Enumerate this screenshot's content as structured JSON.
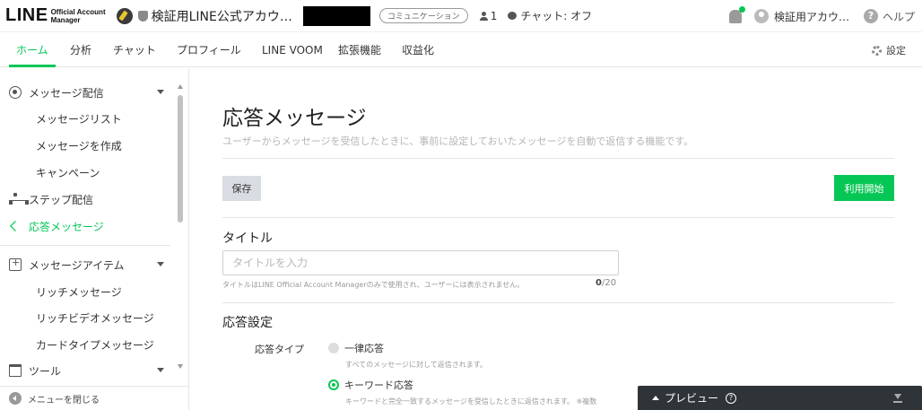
{
  "header": {
    "logo_main": "LINE",
    "logo_sub_1": "Official Account",
    "logo_sub_2": "Manager",
    "account_name": "検証用LINE公式アカウ…",
    "plan_badge": "コミュニケーション",
    "member_count": "1",
    "chat_status": "チャット: オフ",
    "user_name": "検証用アカウ…",
    "help_label": "ヘルプ",
    "help_glyph": "?"
  },
  "nav": {
    "tabs": [
      "ホーム",
      "分析",
      "チャット",
      "プロフィール",
      "LINE VOOM",
      "拡張機能",
      "収益化"
    ],
    "active_tab": "ホーム",
    "settings_label": "設定"
  },
  "sidebar": {
    "sections": {
      "message_delivery": "メッセージ配信",
      "message_list": "メッセージリスト",
      "create_message": "メッセージを作成",
      "campaign": "キャンペーン",
      "step_delivery": "ステップ配信",
      "auto_reply": "応答メッセージ",
      "message_items": "メッセージアイテム",
      "rich_message": "リッチメッセージ",
      "rich_video": "リッチビデオメッセージ",
      "card_message": "カードタイプメッセージ",
      "tools": "ツール"
    },
    "active_item": "応答メッセージ",
    "collapse_label": "メニューを閉じる"
  },
  "main": {
    "title": "応答メッセージ",
    "description": "ユーザーからメッセージを受信したときに、事前に設定しておいたメッセージを自動で返信する機能です。",
    "save_label": "保存",
    "start_label": "利用開始",
    "title_section": "タイトル",
    "title_placeholder": "タイトルを入力",
    "title_hint": "タイトルはLINE Official Account Managerのみで使用され、ユーザーには表示されません。",
    "title_count": "0",
    "title_max": "/20",
    "reply_settings": "応答設定",
    "reply_type_label": "応答タイプ",
    "option_all": "一律応答",
    "option_all_desc": "すべてのメッセージに対して返信されます。",
    "option_keyword": "キーワード応答",
    "option_keyword_desc": "キーワードと完全一致するメッセージを受信したときに返信されます。 ※複数",
    "selected_option": "キーワード応答"
  },
  "preview": {
    "label": "プレビュー",
    "help_glyph": "?"
  },
  "colors": {
    "accent": "#06c755",
    "preview_bar": "#2f3438",
    "save_button": "#d9dce2"
  }
}
